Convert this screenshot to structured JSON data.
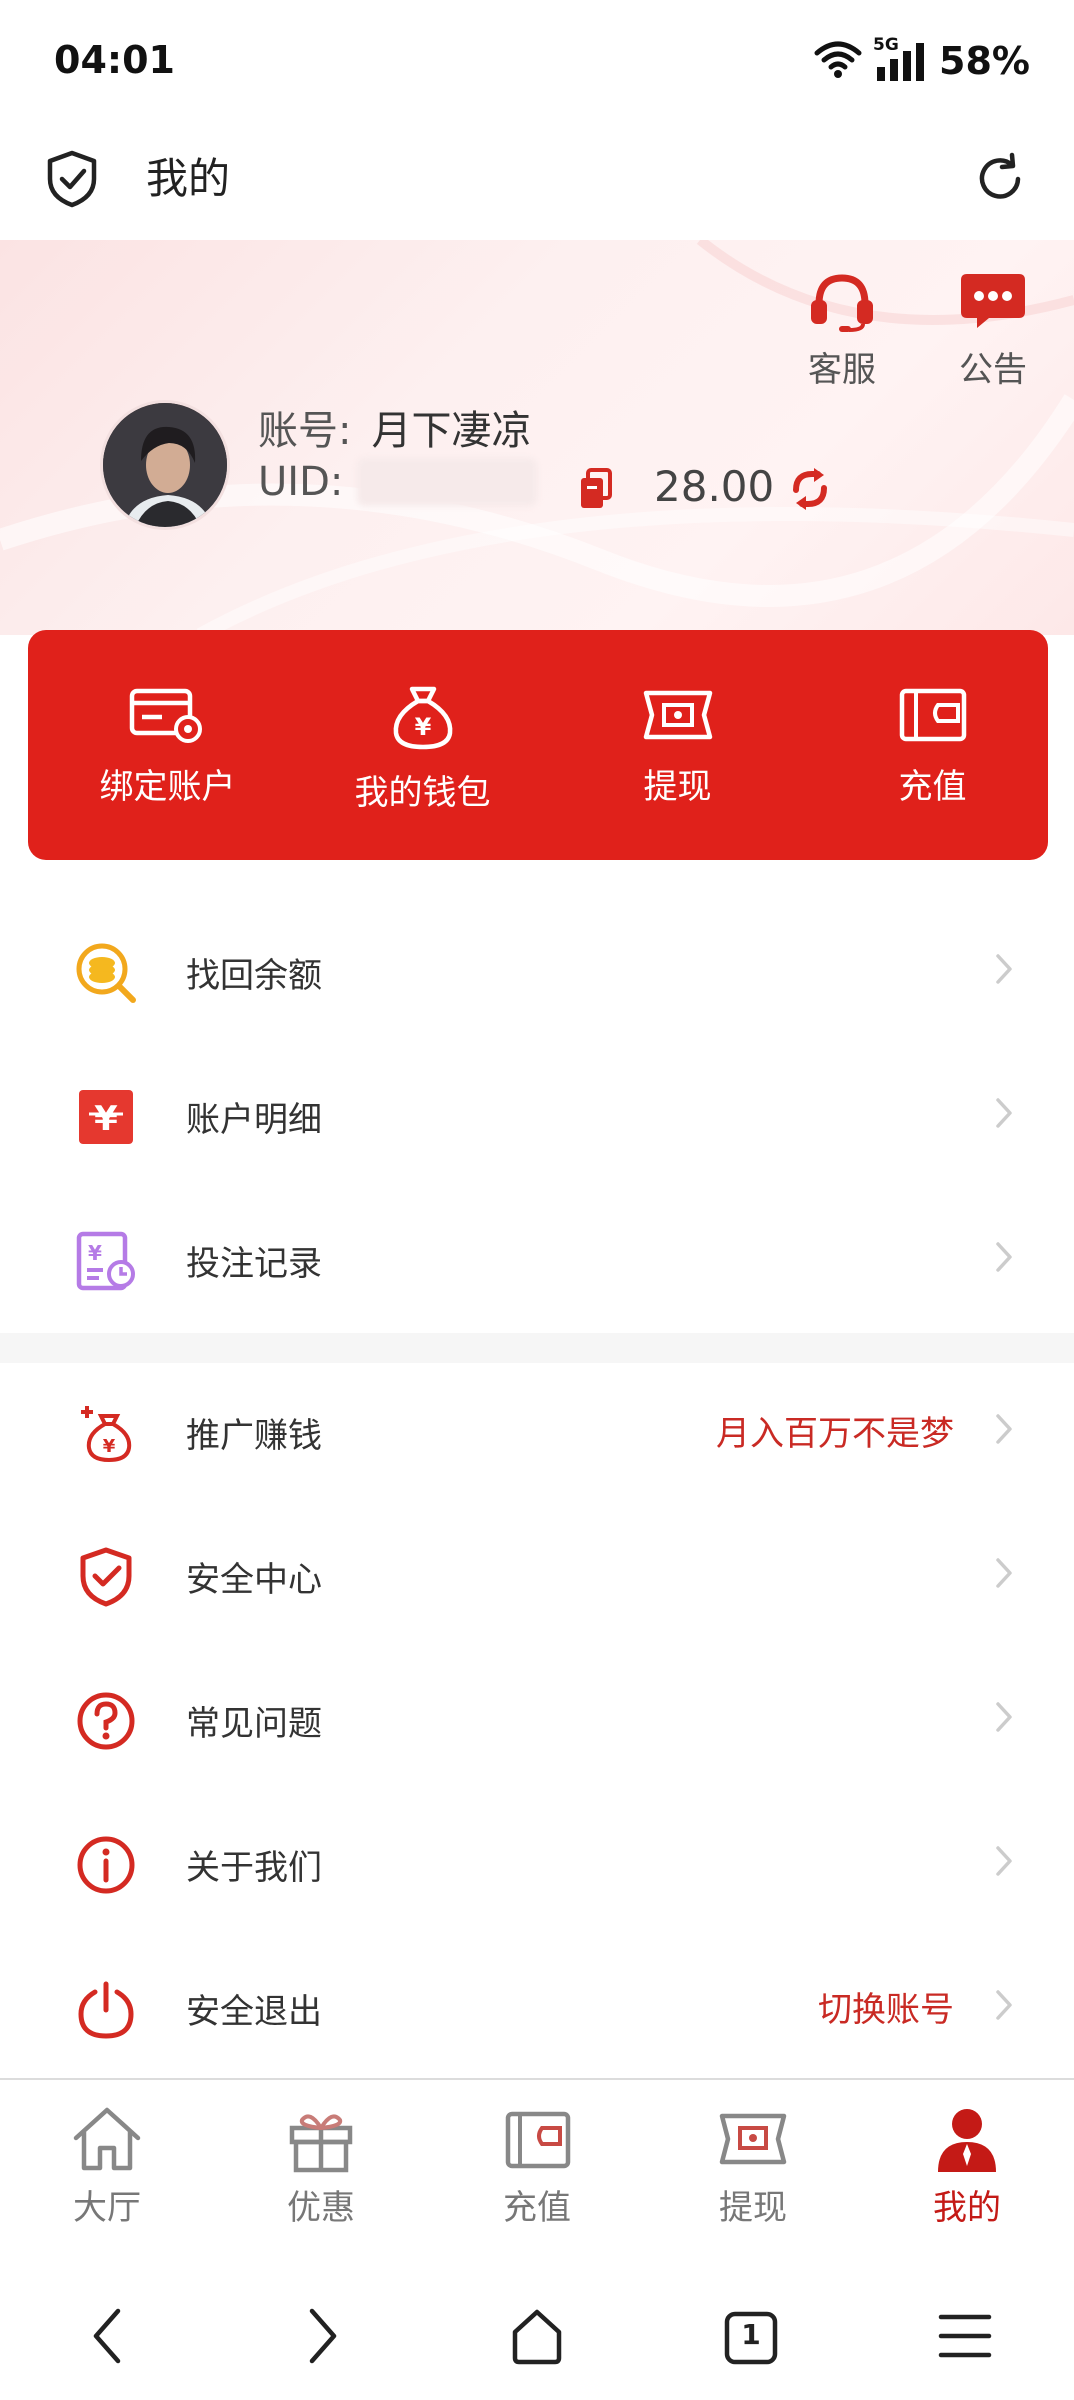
{
  "status_bar": {
    "time": "04:01",
    "network": "5G",
    "battery": "58%"
  },
  "header": {
    "title": "我的"
  },
  "profile": {
    "account_label": "账号:",
    "account_name": "月下凄凉",
    "uid_label": "UID:",
    "balance": "28.00",
    "customer_service_label": "客服",
    "announcement_label": "公告"
  },
  "actions": [
    {
      "label": "绑定账户",
      "icon": "card-settings-icon"
    },
    {
      "label": "我的钱包",
      "icon": "money-bag-icon"
    },
    {
      "label": "提现",
      "icon": "ticket-cash-icon"
    },
    {
      "label": "充值",
      "icon": "wallet-icon"
    }
  ],
  "menu_group_1": [
    {
      "label": "找回余额",
      "icon": "coin-search-icon",
      "extra": ""
    },
    {
      "label": "账户明细",
      "icon": "yen-ledger-icon",
      "extra": ""
    },
    {
      "label": "投注记录",
      "icon": "bet-record-icon",
      "extra": ""
    }
  ],
  "menu_group_2": [
    {
      "label": "推广赚钱",
      "icon": "promote-money-icon",
      "extra": "月入百万不是梦"
    },
    {
      "label": "安全中心",
      "icon": "shield-check-icon",
      "extra": ""
    },
    {
      "label": "常见问题",
      "icon": "question-icon",
      "extra": ""
    },
    {
      "label": "关于我们",
      "icon": "info-icon",
      "extra": ""
    },
    {
      "label": "安全退出",
      "icon": "power-icon",
      "extra": "切换账号"
    }
  ],
  "tabs": [
    {
      "label": "大厅",
      "icon": "home-icon",
      "active": false
    },
    {
      "label": "优惠",
      "icon": "gift-icon",
      "active": false
    },
    {
      "label": "充值",
      "icon": "wallet-icon",
      "active": false
    },
    {
      "label": "提现",
      "icon": "cash-ticket-icon",
      "active": false
    },
    {
      "label": "我的",
      "icon": "user-icon",
      "active": true
    }
  ],
  "browser_nav": {
    "tab_count": "1"
  },
  "colors": {
    "primary_red": "#e0211b",
    "accent_text_red": "#c92a24",
    "active_tab": "#c41a16"
  }
}
